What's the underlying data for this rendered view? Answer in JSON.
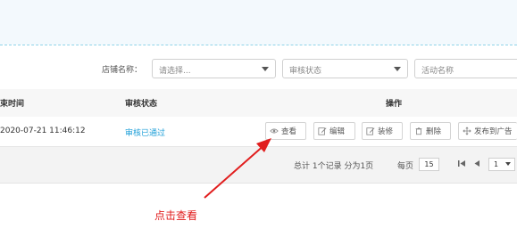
{
  "filters": {
    "store_label": "店铺名称：",
    "store_placeholder": "请选择...",
    "audit_status_placeholder": "审核状态",
    "activity_name_placeholder": "活动名称"
  },
  "table": {
    "columns": [
      "束时间",
      "审核状态",
      "操作"
    ],
    "rows": [
      {
        "end_time": "2020-07-21 11:46:12",
        "audit_status": "审核已通过",
        "actions": {
          "view": "查看",
          "edit": "编辑",
          "decorate": "装修",
          "delete": "删除",
          "publish": "发布到广告"
        }
      }
    ]
  },
  "pagination": {
    "summary": "总计 1个记录 分为1页",
    "per_page_label": "每页",
    "per_page_value": "15",
    "current_page": "1"
  },
  "annotation": {
    "text": "点击查看",
    "color": "#e11d1d"
  },
  "colors": {
    "link": "#1e9fd8",
    "header_bg": "#f7f7f7",
    "top_band": "#f3f9fd"
  }
}
